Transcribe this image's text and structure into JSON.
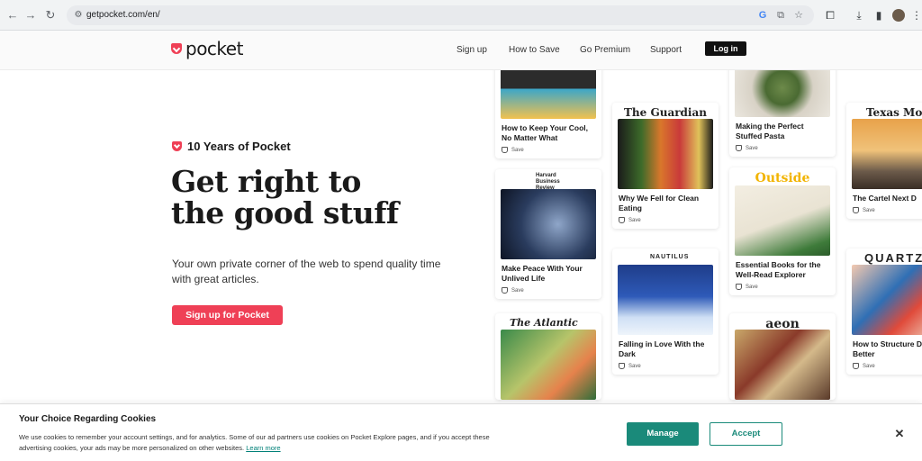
{
  "browser": {
    "url": "getpocket.com/en/",
    "back_icon": "←",
    "forward_icon": "→",
    "reload_icon": "↻",
    "site_info_icon": "⚙",
    "google_icon": "G",
    "share_icon": "⧉",
    "star_icon": "☆",
    "extensions_icon": "⧠",
    "download_icon": "⤓",
    "sidepanel_icon": "▮",
    "menu_icon": "⋮"
  },
  "header": {
    "logo_text": "pocket",
    "links": [
      "Sign up",
      "How to Save",
      "Go Premium",
      "Support"
    ],
    "login_label": "Log in"
  },
  "hero": {
    "tag": "10 Years of Pocket",
    "headline_line1": "Get right to",
    "headline_line2": "the good stuff",
    "subtitle": "Your own private corner of the web to spend quality time with great articles.",
    "cta_label": "Sign up for Pocket"
  },
  "cards": [
    {
      "publisher": "",
      "title": "How to Keep Your Cool, No Matter What",
      "save": "Save"
    },
    {
      "publisher": "Harvard Business Review",
      "title": "Make Peace With Your Unlived Life",
      "save": "Save"
    },
    {
      "publisher": "The Atlantic",
      "title": "",
      "save": ""
    },
    {
      "publisher": "The Guardian",
      "title": "Why We Fell for Clean Eating",
      "save": "Save"
    },
    {
      "publisher": "NAUTILUS",
      "title": "Falling in Love With the Dark",
      "save": "Save"
    },
    {
      "publisher": "",
      "title": "Making the Perfect Stuffed Pasta",
      "save": "Save"
    },
    {
      "publisher": "Outside",
      "title": "Essential Books for the Well-Read Explorer",
      "save": "Save"
    },
    {
      "publisher": "aeon",
      "title": "",
      "save": ""
    },
    {
      "publisher": "Texas Monthly",
      "title": "The Cartel Next D",
      "save": "Save"
    },
    {
      "publisher": "QUARTZ",
      "title": "How to Structure Day Better",
      "save": "Save"
    }
  ],
  "cookie": {
    "title": "Your Choice Regarding Cookies",
    "body": "We use cookies to remember your account settings, and for analytics. Some of our ad partners use cookies on Pocket Explore pages, and if you accept these advertising cookies, your ads may be more personalized on other websites.",
    "learn_more": "Learn more",
    "manage_label": "Manage",
    "accept_label": "Accept",
    "close_icon": "✕"
  }
}
